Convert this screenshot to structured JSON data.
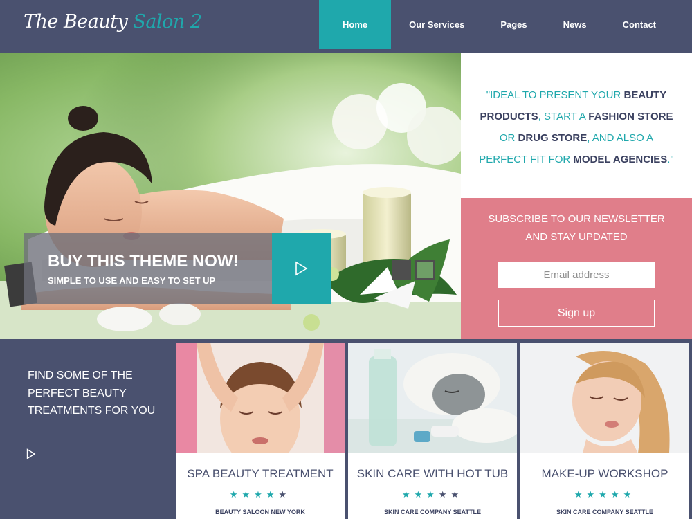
{
  "brand": {
    "logo_part1": "The Beauty",
    "logo_part2": "Salon 2"
  },
  "nav": {
    "items": [
      {
        "label": "Home"
      },
      {
        "label": "Our Services"
      },
      {
        "label": "Pages"
      },
      {
        "label": "News"
      },
      {
        "label": "Contact"
      }
    ],
    "active": "Home"
  },
  "hero": {
    "cta_title": "BUY THIS THEME NOW!",
    "cta_subtitle": "SIMPLE TO USE AND EASY TO SET UP",
    "slides": 2,
    "active_slide": 1
  },
  "quote": {
    "p1": "\"IDEAL TO PRESENT YOUR ",
    "h1": "BEAUTY",
    "h2": "PRODUCTS",
    "p2": ", START A ",
    "h3": "FASHION STORE",
    "p3": "OR ",
    "h4": "DRUG STORE",
    "p4": ", AND ALSO A",
    "p5": "PERFECT FIT FOR ",
    "h5": "MODEL AGENCIES",
    "p6": ".\""
  },
  "newsletter": {
    "title_line1": "SUBSCRIBE TO OUR NEWSLETTER",
    "title_line2": "AND STAY UPDATED",
    "email_placeholder": "Email address",
    "signup_label": "Sign up"
  },
  "treatments": {
    "heading": "FIND SOME OF THE PERFECT BEAUTY TREATMENTS FOR YOU",
    "cards": [
      {
        "title": "SPA BEAUTY TREATMENT",
        "rating": 4,
        "max": 5,
        "subtitle": "BEAUTY SALOON NEW YORK"
      },
      {
        "title": "SKIN CARE WITH HOT TUB",
        "rating": 3,
        "max": 5,
        "subtitle": "SKIN CARE COMPANY SEATTLE"
      },
      {
        "title": "MAKE-UP WORKSHOP",
        "rating": 5,
        "max": 5,
        "subtitle": "SKIN CARE COMPANY SEATTLE"
      }
    ]
  },
  "colors": {
    "header_bg": "#4a516f",
    "accent_teal": "#1fa8ac",
    "newsletter_pink": "#e07e8a"
  }
}
